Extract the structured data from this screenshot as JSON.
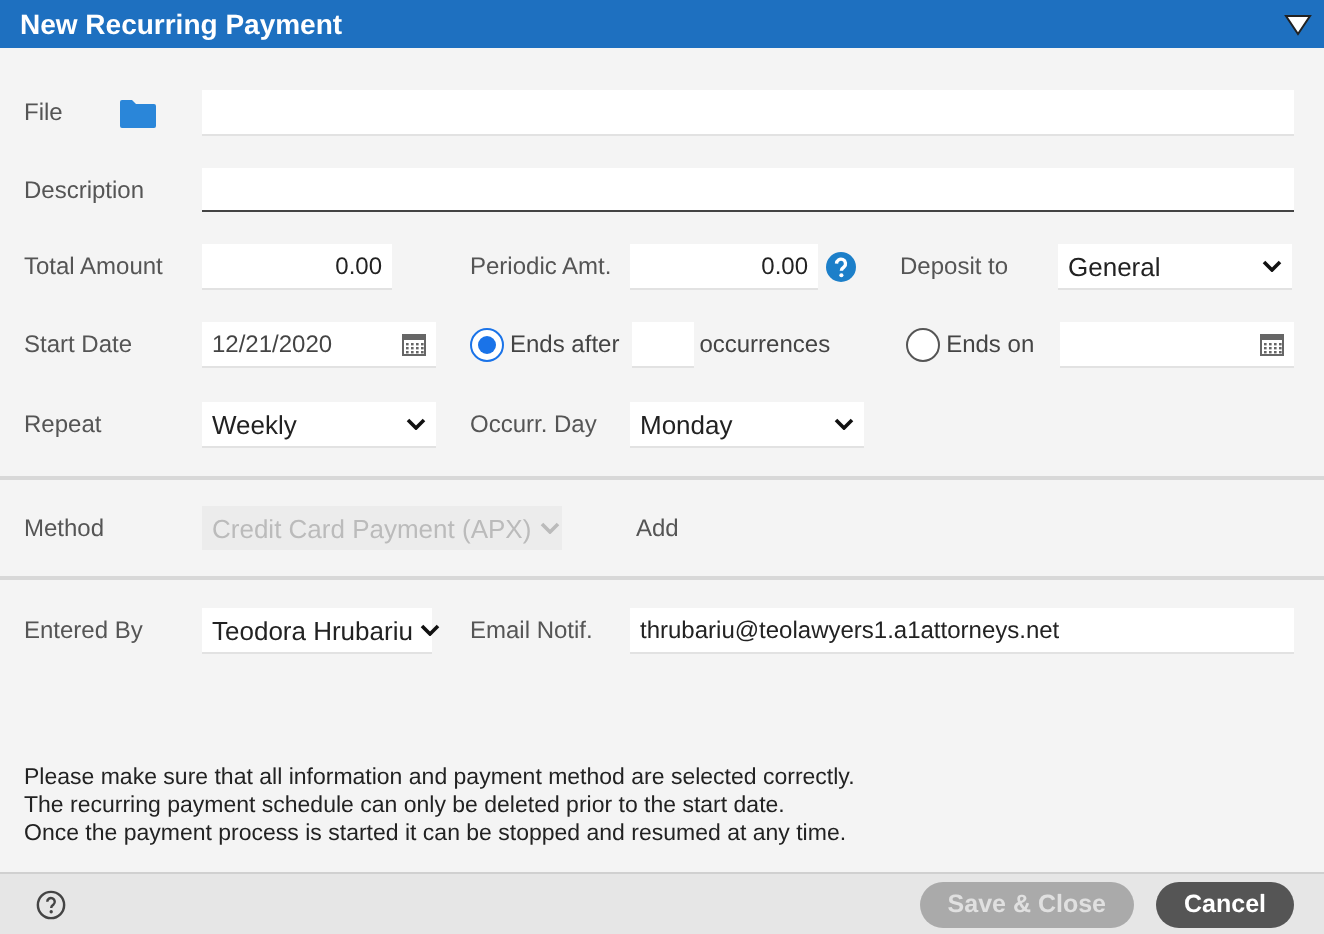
{
  "title": "New Recurring Payment",
  "file": {
    "label": "File"
  },
  "description": {
    "label": "Description",
    "focused": true
  },
  "total_amount": {
    "label": "Total Amount",
    "value": "0.00"
  },
  "periodic_amt": {
    "label": "Periodic Amt.",
    "value": "0.00"
  },
  "deposit_to": {
    "label": "Deposit to",
    "value": "General"
  },
  "start_date": {
    "label": "Start Date",
    "value": "12/21/2020"
  },
  "ends_after": {
    "label": "Ends after",
    "selected": true,
    "suffix": "occurrences"
  },
  "ends_on": {
    "label": "Ends on",
    "selected": false
  },
  "repeat": {
    "label": "Repeat",
    "value": "Weekly"
  },
  "occurr_day": {
    "label": "Occurr. Day",
    "value": "Monday"
  },
  "method": {
    "label": "Method",
    "value": "Credit Card Payment (APX)",
    "disabled": true
  },
  "add_link": "Add",
  "entered_by": {
    "label": "Entered By",
    "value": "Teodora Hrubariu"
  },
  "email_notif": {
    "label": "Email Notif.",
    "value": "thrubariu@teolawyers1.a1attorneys.net"
  },
  "notes": [
    "Please make sure that all information and payment method are selected correctly.",
    "The recurring payment schedule can only be deleted prior to the start date.",
    "Once the payment process is started it can be stopped and resumed at any time."
  ],
  "buttons": [
    {
      "label": "Save & Close",
      "disabled": true
    },
    {
      "label": "Cancel",
      "disabled": false
    }
  ]
}
